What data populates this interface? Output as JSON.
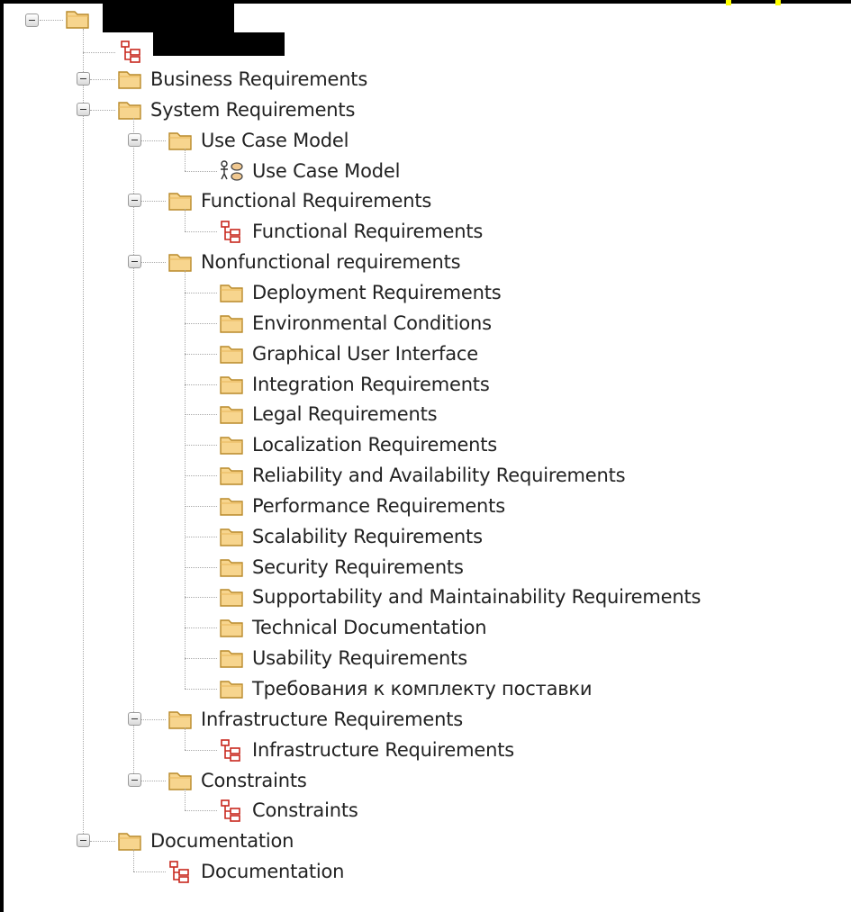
{
  "tree": {
    "nodes": [
      {
        "id": "n01",
        "depth": 1,
        "icon": "folder",
        "label": "Business Requirements",
        "expanded": false
      },
      {
        "id": "n02",
        "depth": 1,
        "icon": "folder",
        "label": "System Requirements",
        "expanded": true
      },
      {
        "id": "n03",
        "depth": 2,
        "icon": "folder",
        "label": "Use Case Model",
        "expanded": true
      },
      {
        "id": "n04",
        "depth": 3,
        "icon": "usecase",
        "label": "Use Case Model"
      },
      {
        "id": "n05",
        "depth": 2,
        "icon": "folder",
        "label": "Functional Requirements",
        "expanded": true
      },
      {
        "id": "n06",
        "depth": 3,
        "icon": "diagram",
        "label": "Functional Requirements"
      },
      {
        "id": "n07",
        "depth": 2,
        "icon": "folder",
        "label": "Nonfunctional requirements",
        "expanded": true
      },
      {
        "id": "n08",
        "depth": 3,
        "icon": "folder",
        "label": "Deployment Requirements"
      },
      {
        "id": "n09",
        "depth": 3,
        "icon": "folder",
        "label": "Environmental Conditions"
      },
      {
        "id": "n10",
        "depth": 3,
        "icon": "folder",
        "label": "Graphical User Interface"
      },
      {
        "id": "n11",
        "depth": 3,
        "icon": "folder",
        "label": "Integration Requirements"
      },
      {
        "id": "n12",
        "depth": 3,
        "icon": "folder",
        "label": "Legal Requirements"
      },
      {
        "id": "n13",
        "depth": 3,
        "icon": "folder",
        "label": "Localization Requirements"
      },
      {
        "id": "n14",
        "depth": 3,
        "icon": "folder",
        "label": "Reliability and Availability Requirements"
      },
      {
        "id": "n15",
        "depth": 3,
        "icon": "folder",
        "label": "Performance Requirements"
      },
      {
        "id": "n16",
        "depth": 3,
        "icon": "folder",
        "label": "Scalability Requirements"
      },
      {
        "id": "n17",
        "depth": 3,
        "icon": "folder",
        "label": "Security Requirements"
      },
      {
        "id": "n18",
        "depth": 3,
        "icon": "folder",
        "label": "Supportability and Maintainability Requirements"
      },
      {
        "id": "n19",
        "depth": 3,
        "icon": "folder",
        "label": "Technical Documentation"
      },
      {
        "id": "n20",
        "depth": 3,
        "icon": "folder",
        "label": "Usability Requirements"
      },
      {
        "id": "n21",
        "depth": 3,
        "icon": "folder",
        "label": "Требования к комплекту поставки"
      },
      {
        "id": "n22",
        "depth": 2,
        "icon": "folder",
        "label": "Infrastructure Requirements",
        "expanded": true
      },
      {
        "id": "n23",
        "depth": 3,
        "icon": "diagram",
        "label": "Infrastructure Requirements"
      },
      {
        "id": "n24",
        "depth": 2,
        "icon": "folder",
        "label": "Constraints",
        "expanded": true
      },
      {
        "id": "n25",
        "depth": 3,
        "icon": "diagram",
        "label": "Constraints"
      },
      {
        "id": "n26",
        "depth": 1,
        "icon": "folder",
        "label": "Documentation",
        "expanded": true
      },
      {
        "id": "n27",
        "depth": 2,
        "icon": "diagram",
        "label": "Documentation"
      }
    ]
  },
  "colors": {
    "folder_fill": "#f7d58e",
    "folder_stroke": "#b98a2a",
    "diagram_red": "#c8281e",
    "redaction": "#000000",
    "highlight": "#ffff00"
  }
}
